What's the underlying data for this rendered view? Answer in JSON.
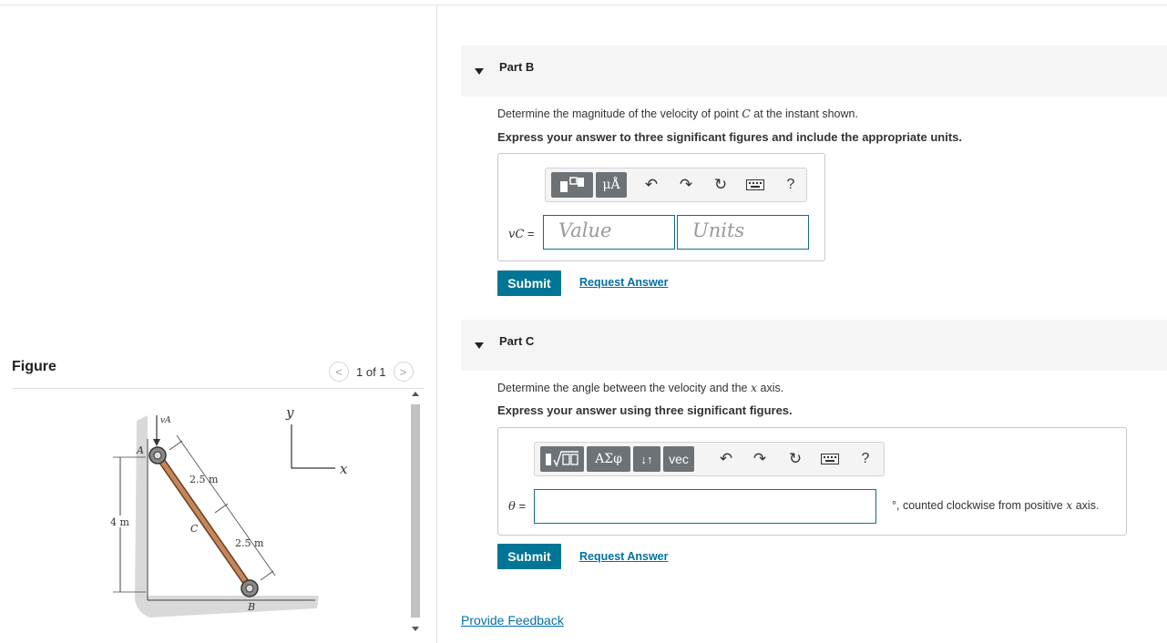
{
  "figure": {
    "title": "Figure",
    "pager": {
      "prev": "<",
      "text": "1 of 1",
      "next": ">"
    },
    "labels": {
      "va": "vA",
      "a": "A",
      "b": "B",
      "c": "C",
      "x": "x",
      "y": "y",
      "seg1": "2.5 m",
      "seg2": "2.5 m",
      "height": "4 m"
    }
  },
  "partB": {
    "title": "Part B",
    "question_pre": "Determine the magnitude of the velocity of point ",
    "question_var": "C",
    "question_post": " at the instant shown.",
    "instruction": "Express your answer to three significant figures and include the appropriate units.",
    "toolbar": {
      "templates_icon": "templates-icon",
      "units_label": "μÅ",
      "help_label": "?"
    },
    "answer_label_var": "vC",
    "answer_label_eq": " =",
    "value_placeholder": "Value",
    "units_placeholder": "Units",
    "submit_label": "Submit",
    "request_label": "Request Answer"
  },
  "partC": {
    "title": "Part C",
    "question_pre": "Determine the angle between the velocity and the ",
    "question_var": "x",
    "question_post": " axis.",
    "instruction": "Express your answer using three significant figures.",
    "toolbar": {
      "math_icon": "sqrt-template-icon",
      "greek_label": "ΑΣφ",
      "arrows_label": "↓↑",
      "vec_label": "vec",
      "help_label": "?"
    },
    "answer_label_var": "θ",
    "answer_label_eq": " =",
    "suffix_pre": "°, counted clockwise from positive ",
    "suffix_var": "x",
    "suffix_post": " axis.",
    "submit_label": "Submit",
    "request_label": "Request Answer"
  },
  "footer": {
    "feedback_label": "Provide Feedback"
  },
  "colors": {
    "accent": "#007595",
    "link": "#0071a5",
    "field_border": "#0e6d8c",
    "toolbar_btn": "#6d7276"
  }
}
